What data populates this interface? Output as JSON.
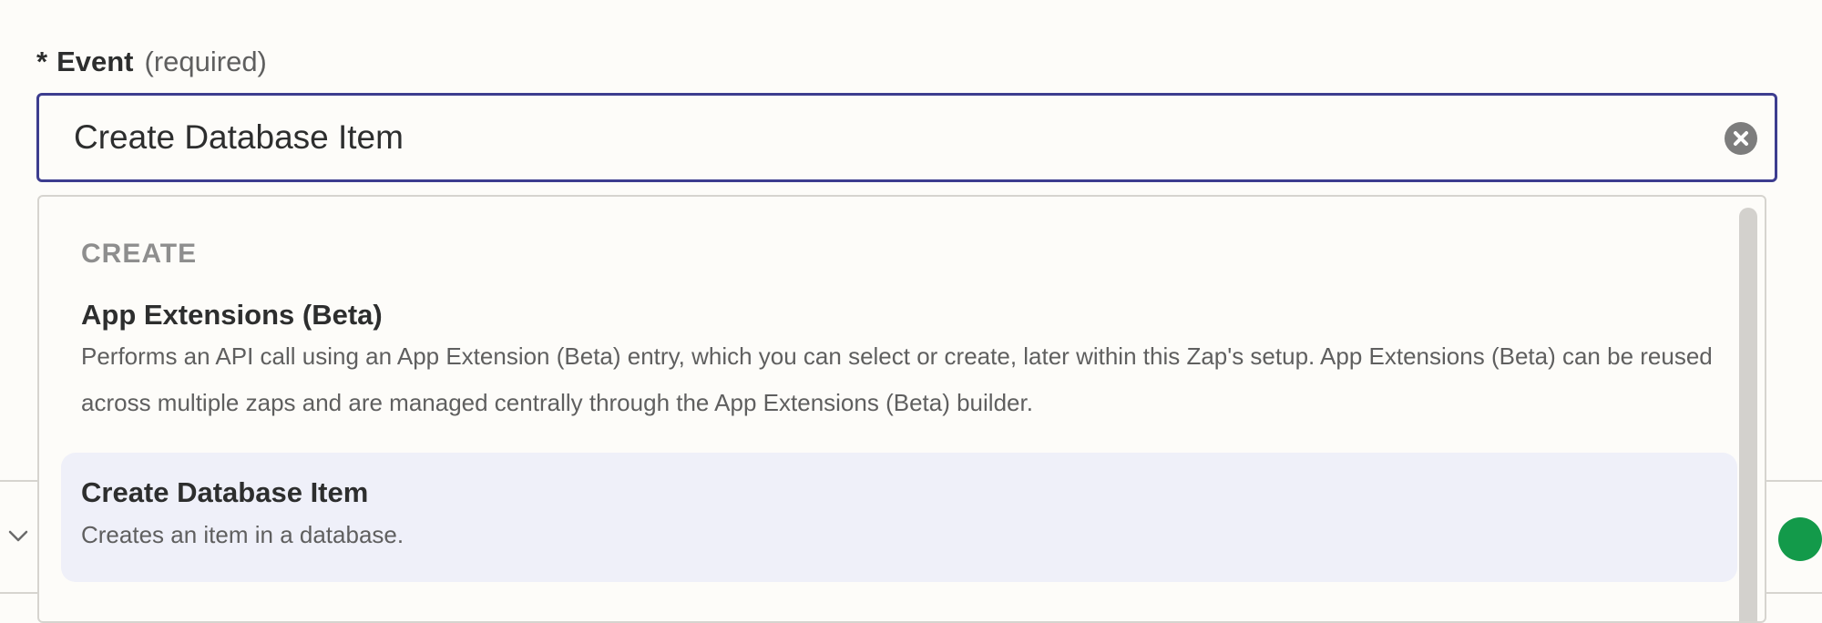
{
  "field": {
    "required_marker": "*",
    "label": "Event",
    "hint": "(required)"
  },
  "input": {
    "value": "Create Database Item",
    "clear_icon": "close-circle-icon"
  },
  "dropdown": {
    "group_heading": "CREATE",
    "options": [
      {
        "title": "App Extensions (Beta)",
        "description": "Performs an API call using an App Extension (Beta) entry, which you can select or create, later within this Zap's setup. App Extensions (Beta) can be reused across multiple zaps and are managed centrally through the App Extensions (Beta) builder.",
        "highlighted": false
      },
      {
        "title": "Create Database Item",
        "description": "Creates an item in a database.",
        "highlighted": true
      }
    ]
  },
  "colors": {
    "accent_border": "#3d3d8f",
    "highlight_bg": "#eff0f9",
    "status_green": "#139a4a"
  },
  "background": {
    "chevron_icon": "chevron-down-icon",
    "status_icon": "green-status-dot-icon"
  }
}
